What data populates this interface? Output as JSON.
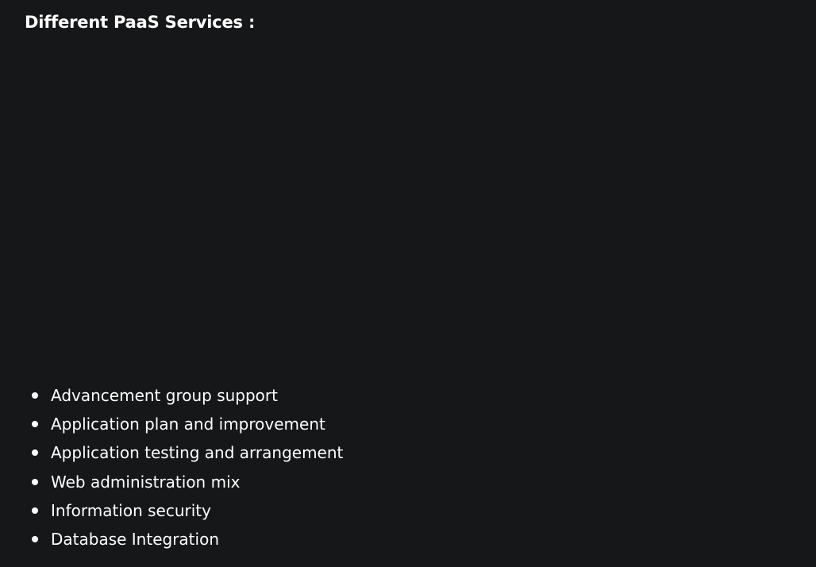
{
  "heading": "Different PaaS Services :",
  "services": [
    "Advancement group support",
    "Application plan and improvement",
    "Application testing and arrangement",
    "Web administration mix",
    "Information security",
    "Database Integration"
  ],
  "colors": {
    "background": "#161719",
    "text": "#ffffff"
  }
}
